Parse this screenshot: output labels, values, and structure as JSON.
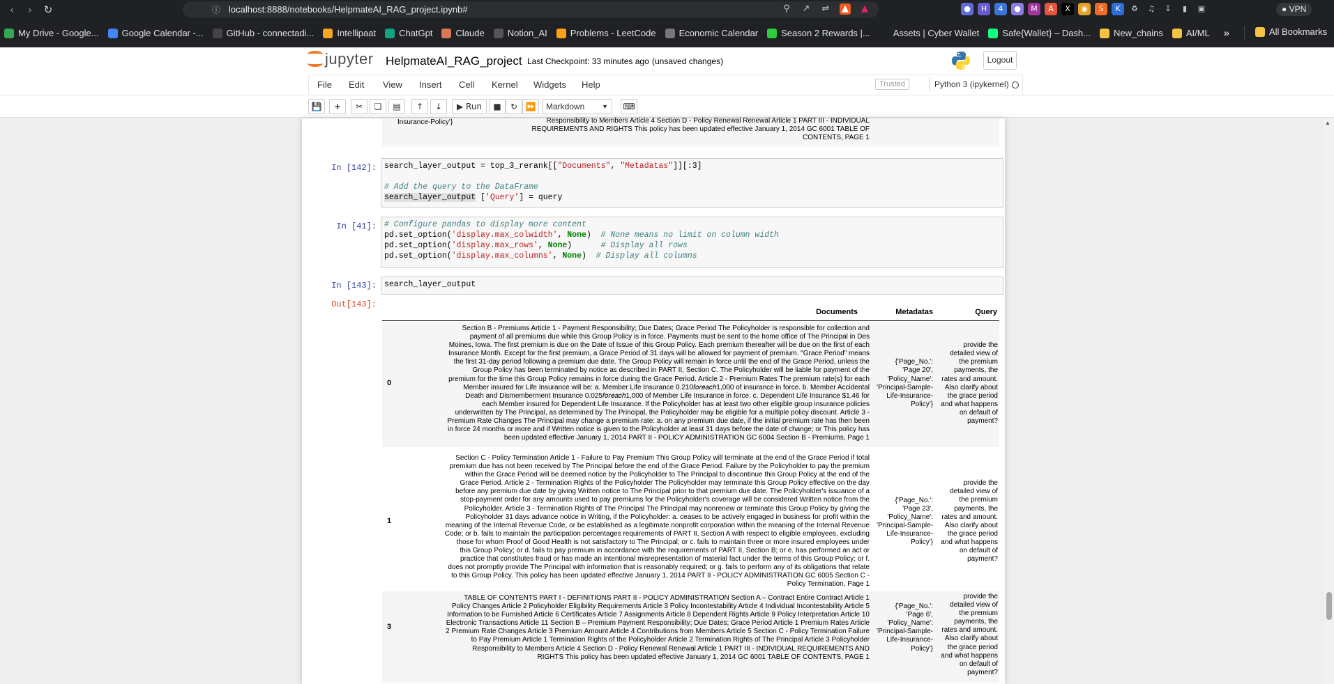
{
  "browser": {
    "url": "localhost:8888/notebooks/HelpmateAI_RAG_project.ipynb#",
    "vpn_label": "VPN",
    "bookmarks": [
      {
        "label": "My Drive - Google...",
        "icon": "drive-icon",
        "color": "#34a853"
      },
      {
        "label": "Google Calendar -...",
        "icon": "calendar-icon",
        "color": "#4285f4"
      },
      {
        "label": "GitHub - connectadi...",
        "icon": "github-icon",
        "color": "#444444"
      },
      {
        "label": "Intellipaat",
        "icon": "intellipaat-icon",
        "color": "#f5a623"
      },
      {
        "label": "ChatGpt",
        "icon": "chatgpt-icon",
        "color": "#10a37f"
      },
      {
        "label": "Claude",
        "icon": "claude-icon",
        "color": "#d97757"
      },
      {
        "label": "Notion_AI",
        "icon": "notion-icon",
        "color": "#555555"
      },
      {
        "label": "Problems - LeetCode",
        "icon": "leetcode-icon",
        "color": "#ffa116"
      },
      {
        "label": "Economic Calendar",
        "icon": "economic-icon",
        "color": "#777777"
      },
      {
        "label": "Season 2 Rewards |...",
        "icon": "rewards-icon",
        "color": "#2ecc40"
      },
      {
        "label": "Assets | Cyber Wallet",
        "icon": "wallet-icon",
        "color": "#1f2124"
      },
      {
        "label": "Safe{Wallet} – Dash...",
        "icon": "safe-icon",
        "color": "#12ff80"
      },
      {
        "label": "New_chains",
        "icon": "folder-icon",
        "color": "#f5c242"
      },
      {
        "label": "AI/ML",
        "icon": "folder-icon",
        "color": "#f5c242"
      }
    ],
    "all_bookmarks": "All Bookmarks"
  },
  "jupyter": {
    "logo_text": "jupyter",
    "notebook_name": "HelpmateAI_RAG_project",
    "checkpoint": "Last Checkpoint: 33 minutes ago",
    "unsaved": "(unsaved changes)",
    "logout": "Logout",
    "menu": [
      "File",
      "Edit",
      "View",
      "Insert",
      "Cell",
      "Kernel",
      "Widgets",
      "Help"
    ],
    "trusted": "Trusted",
    "kernel": "Python 3 (ipykernel)",
    "toolbar": {
      "run_label": "Run",
      "cell_type": "Markdown"
    }
  },
  "prev_output": {
    "meta_tail": "Insurance-Policy'}",
    "doc_tail_lines": [
      "Responsibility to Members Article 4 Section D - Policy Renewal Renewal Article 1 PART III - INDIVIDUAL",
      "REQUIREMENTS AND RIGHTS This policy has been updated effective January 1, 2014 GC 6001 TABLE OF",
      "CONTENTS, PAGE 1"
    ]
  },
  "cells": [
    {
      "prompt": "In [142]:",
      "lines": [
        "search_layer_output = top_3_rerank[[\"Documents\", \"Metadatas\"]][:3]",
        "",
        "# Add the query to the DataFrame",
        "search_layer_output ['Query'] = query"
      ]
    },
    {
      "prompt": "In [41]:",
      "lines": [
        "# Configure pandas to display more content",
        "pd.set_option('display.max_colwidth', None)  # None means no limit on column width",
        "pd.set_option('display.max_rows', None)      # Display all rows",
        "pd.set_option('display.max_columns', None)  # Display all columns"
      ]
    },
    {
      "prompt": "In [143]:",
      "lines": [
        "search_layer_output"
      ]
    }
  ],
  "output": {
    "prompt": "Out[143]:",
    "columns": [
      "Documents",
      "Metadatas",
      "Query"
    ],
    "rows": [
      {
        "index": "0",
        "doc_lines": [
          "Section B - Premiums Article 1 - Payment Responsibility; Due Dates; Grace Period The Policyholder is responsible for collection and",
          "payment of all premiums due while this Group Policy is in force. Payments must be sent to the home office of The Principal in Des",
          "Moines, Iowa. The first premium is due on the Date of Issue of this Group Policy. Each premium thereafter will be due on the first of each",
          "Insurance Month. Except for the first premium, a Grace Period of 31 days will be allowed for payment of premium. \"Grace Period\" means",
          "the first 31-day period following a premium due date. The Group Policy will remain in force until the end of the Grace Period, unless the",
          "Group Policy has been terminated by notice as described in PART II, Section C. The Policyholder will be liable for payment of the",
          "premium for the time this Group Policy remains in force during the Grace Period. Article 2 - Premium Rates The premium rate(s) for each",
          "Member insured for Life Insurance will be: a. Member Life Insurance 0.210𝑓𝑜𝑟𝑒𝑎𝑐ℎ1,000 of insurance in force. b. Member Accidental",
          "Death and Dismemberment Insurance 0.025𝑓𝑜𝑟𝑒𝑎𝑐ℎ1,000 of Member Life Insurance in force. c. Dependent Life Insurance $1.46 for",
          "each Member insured for Dependent Life Insurance. If the Policyholder has at least two other eligible group insurance policies",
          "underwritten by The Principal, as determined by The Principal, the Policyholder may be eligible for a multiple policy discount. Article 3 -",
          "Premium Rate Changes The Principal may change a premium rate: a. on any premium due date, if the initial premium rate has then been",
          "in force 24 months or more and if Written notice is given to the Policyholder at least 31 days before the date of change; or This policy has",
          "been updated effective January 1, 2014 PART II - POLICY ADMINISTRATION GC 6004 Section B - Premiums, Page 1"
        ],
        "meta_lines": [
          "{'Page_No.':",
          "'Page 20',",
          "'Policy_Name':",
          "'Principal-Sample-",
          "Life-Insurance-",
          "Policy'}"
        ],
        "query_lines": [
          "provide the",
          "detailed view of",
          "the premium",
          "payments, the",
          "rates and amount.",
          "Also clarify about",
          "the grace period",
          "and what happens",
          "on default of",
          "payment?"
        ]
      },
      {
        "index": "1",
        "doc_lines": [
          "Section C - Policy Termination Article 1 - Failure to Pay Premium This Group Policy will terminate at the end of the Grace Period if total",
          "premium due has not been received by The Principal before the end of the Grace Period. Failure by the Policyholder to pay the premium",
          "within the Grace Period will be deemed notice by the Policyholder to The Principal to discontinue this Group Policy at the end of the",
          "Grace Period. Article 2 - Termination Rights of the Policyholder The Policyholder may terminate this Group Policy effective on the day",
          "before any premium due date by giving Written notice to The Principal prior to that premium due date. The Policyholder's issuance of a",
          "stop-payment order for any amounts used to pay premiums for the Policyholder's coverage will be considered Written notice from the",
          "Policyholder. Article 3 - Termination Rights of The Principal The Principal may nonrenew or terminate this Group Policy by giving the",
          "Policyholder 31 days advance notice in Writing, if the Policyholder: a. ceases to be actively engaged in business for profit within the",
          "meaning of the Internal Revenue Code, or be established as a legitimate nonprofit corporation within the meaning of the Internal Revenue",
          "Code; or b. fails to maintain the participation percentages requirements of PART II, Section A with respect to eligible employees, excluding",
          "those for whom Proof of Good Health is not satisfactory to The Principal; or c. fails to maintain three or more insured employees under",
          "this Group Policy; or d. fails to pay premium in accordance with the requirements of PART II, Section B; or e. has performed an act or",
          "practice that constitutes fraud or has made an intentional misrepresentation of material fact under the terms of this Group Policy; or f.",
          "does not promptly provide The Principal with information that is reasonably required; or g. fails to perform any of its obligations that relate",
          "to this Group Policy. This policy has been updated effective January 1, 2014 PART II - POLICY ADMINISTRATION GC 6005 Section C -",
          "Policy Termination, Page 1"
        ],
        "meta_lines": [
          "{'Page_No.':",
          "'Page 23',",
          "'Policy_Name':",
          "'Principal-Sample-",
          "Life-Insurance-",
          "Policy'}"
        ],
        "query_lines": [
          "provide the",
          "detailed view of",
          "the premium",
          "payments, the",
          "rates and amount.",
          "Also clarify about",
          "the grace period",
          "and what happens",
          "on default of",
          "payment?"
        ]
      },
      {
        "index": "3",
        "doc_lines": [
          "TABLE OF CONTENTS PART I - DEFINITIONS PART II - POLICY ADMINISTRATION Section A – Contract Entire Contract Article 1",
          "Policy Changes Article 2 Policyholder Eligibility Requirements Article 3 Policy Incontestability Article 4 Individual Incontestability Article 5",
          "Information to be Furnished Article 6 Certificates Article 7 Assignments Article 8 Dependent Rights Article 9 Policy Interpretation Article 10",
          "Electronic Transactions Article 11 Section B – Premium Payment Responsibility; Due Dates; Grace Period Article 1 Premium Rates Article",
          "2 Premium Rate Changes Article 3 Premium Amount Article 4 Contributions from Members Article 5 Section C - Policy Termination Failure",
          "to Pay Premium Article 1 Termination Rights of the Policyholder Article 2 Termination Rights of The Principal Article 3 Policyholder",
          "Responsibility to Members Article 4 Section D - Policy Renewal Renewal Article 1 PART III - INDIVIDUAL REQUIREMENTS AND",
          "RIGHTS This policy has been updated effective January 1, 2014 GC 6001 TABLE OF CONTENTS, PAGE 1"
        ],
        "meta_lines": [
          "{'Page_No.':",
          "'Page 6',",
          "'Policy_Name':",
          "'Principal-Sample-",
          "Life-Insurance-",
          "Policy'}"
        ],
        "query_lines": [
          "provide the",
          "detailed view of",
          "the premium",
          "payments, the",
          "rates and amount.",
          "Also clarify about",
          "the grace period",
          "and what happens",
          "on default of",
          "payment?"
        ]
      }
    ]
  }
}
